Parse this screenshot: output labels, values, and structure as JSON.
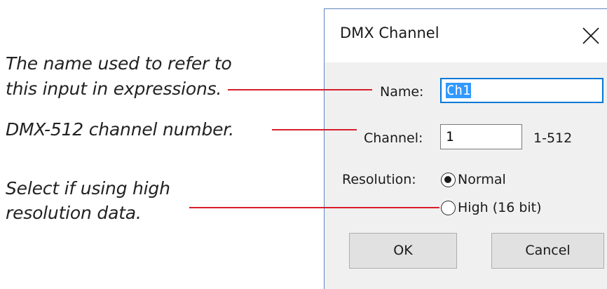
{
  "annotations": {
    "name_line1": "The name used to refer to",
    "name_line2": "this input in expressions.",
    "channel": "DMX-512 channel number.",
    "resolution_line1": "Select if using high",
    "resolution_line2": "resolution data."
  },
  "dialog": {
    "title": "DMX Channel",
    "close_glyph": "×",
    "name_label": "Name:",
    "name_value": "Ch1",
    "channel_label": "Channel:",
    "channel_value": "1",
    "channel_range": "1-512",
    "resolution_label": "Resolution:",
    "resolution_options": [
      {
        "label": "Normal",
        "selected": true
      },
      {
        "label": "High (16 bit)",
        "selected": false
      }
    ],
    "ok_label": "OK",
    "cancel_label": "Cancel"
  },
  "colors": {
    "callout_line": "#d81e2c",
    "focus_border": "#0078d7",
    "selection": "#3399ff",
    "dialog_border": "#5d86c0"
  }
}
